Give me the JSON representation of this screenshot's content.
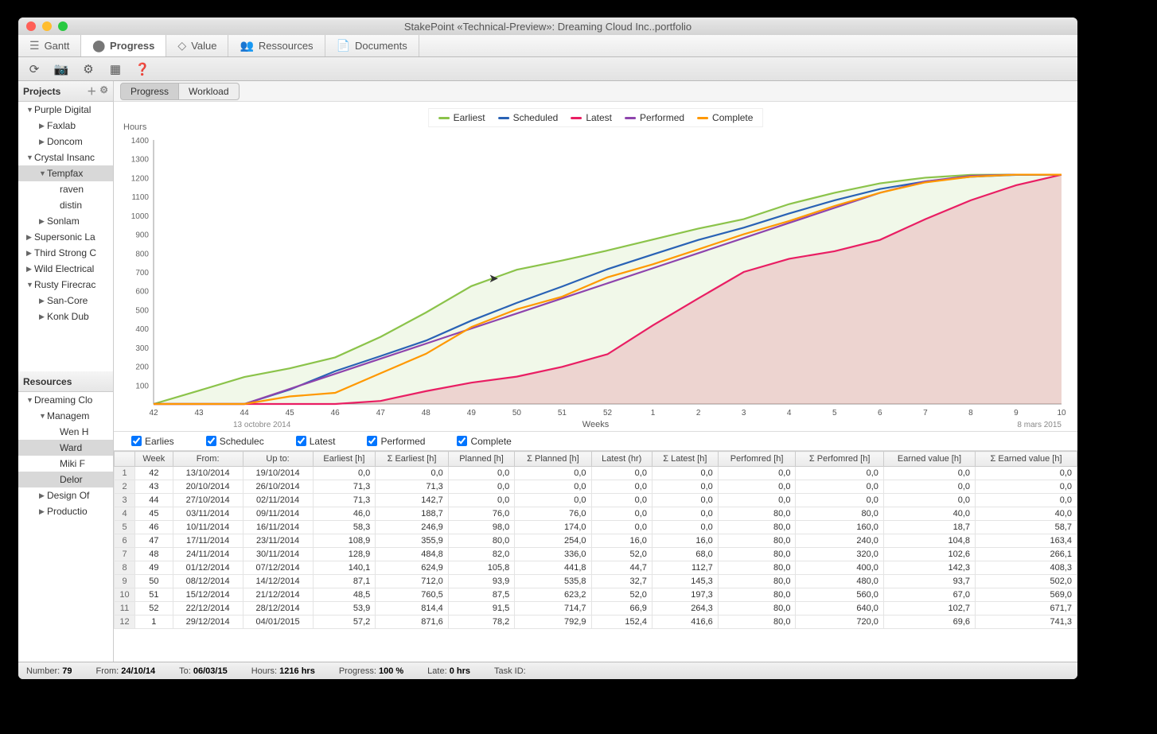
{
  "title": "StakePoint  «Technical-Preview»:  Dreaming Cloud Inc..portfolio",
  "maintabs": [
    "Gantt",
    "Progress",
    "Value",
    "Ressources",
    "Documents"
  ],
  "maintabs_active": 1,
  "sidebar": {
    "projects_label": "Projects",
    "resources_label": "Resources",
    "projects": [
      {
        "l": 1,
        "t": "Purple Digital",
        "a": "▼"
      },
      {
        "l": 2,
        "t": "Faxlab",
        "a": "▶"
      },
      {
        "l": 2,
        "t": "Doncom",
        "a": "▶"
      },
      {
        "l": 1,
        "t": "Crystal Insanc",
        "a": "▼"
      },
      {
        "l": 2,
        "t": "Tempfax",
        "a": "▼",
        "sel": true
      },
      {
        "l": 3,
        "t": "raven",
        "a": ""
      },
      {
        "l": 3,
        "t": "distin",
        "a": ""
      },
      {
        "l": 2,
        "t": "Sonlam",
        "a": "▶"
      },
      {
        "l": 1,
        "t": "Supersonic La",
        "a": "▶"
      },
      {
        "l": 1,
        "t": "Third Strong C",
        "a": "▶"
      },
      {
        "l": 1,
        "t": "Wild Electrical",
        "a": "▶"
      },
      {
        "l": 1,
        "t": "Rusty Firecrac",
        "a": "▼"
      },
      {
        "l": 2,
        "t": "San-Core",
        "a": "▶"
      },
      {
        "l": 2,
        "t": "Konk Dub",
        "a": "▶"
      }
    ],
    "resources": [
      {
        "l": 1,
        "t": "Dreaming Clo",
        "a": "▼"
      },
      {
        "l": 2,
        "t": "Managem",
        "a": "▼"
      },
      {
        "l": 3,
        "t": "Wen H",
        "a": ""
      },
      {
        "l": 3,
        "t": "Ward",
        "a": "",
        "sel": true
      },
      {
        "l": 3,
        "t": "Miki F",
        "a": ""
      },
      {
        "l": 3,
        "t": "Delor",
        "a": "",
        "sel": true
      },
      {
        "l": 2,
        "t": "Design Of",
        "a": "▶"
      },
      {
        "l": 2,
        "t": "Productio",
        "a": "▶"
      }
    ]
  },
  "subtabs": [
    "Progress",
    "Workload"
  ],
  "subtabs_active": 0,
  "legend": [
    {
      "name": "Earliest",
      "color": "#8bc34a"
    },
    {
      "name": "Scheduled",
      "color": "#2962b5"
    },
    {
      "name": "Latest",
      "color": "#e91e63"
    },
    {
      "name": "Performed",
      "color": "#8e44ad"
    },
    {
      "name": "Complete",
      "color": "#ff9800"
    }
  ],
  "ylabel": "Hours",
  "xaxis_label": "Weeks",
  "x_ticks": [
    "42",
    "43",
    "44",
    "45",
    "46",
    "47",
    "48",
    "49",
    "50",
    "51",
    "52",
    "1",
    "2",
    "3",
    "4",
    "5",
    "6",
    "7",
    "8",
    "9",
    "10"
  ],
  "y_ticks": [
    100,
    200,
    300,
    400,
    500,
    600,
    700,
    800,
    900,
    1000,
    1100,
    1200,
    1300,
    1400
  ],
  "date_left": "13 octobre 2014",
  "date_right": "8 mars 2015",
  "checks": [
    "Earlies",
    "Schedulec",
    "Latest",
    "Performed",
    "Complete"
  ],
  "table": {
    "headers": [
      "",
      "Week",
      "From:",
      "Up to:",
      "Earliest [h]",
      "Σ Earliest [h]",
      "Planned [h]",
      "Σ Planned [h]",
      "Latest (hr)",
      "Σ Latest [h]",
      "Perfomred [h]",
      "Σ Perfomred [h]",
      "Earned value [h]",
      "Σ Earned value [h]"
    ],
    "rows": [
      [
        "1",
        "42",
        "13/10/2014",
        "19/10/2014",
        "0,0",
        "0,0",
        "0,0",
        "0,0",
        "0,0",
        "0,0",
        "0,0",
        "0,0",
        "0,0",
        "0,0"
      ],
      [
        "2",
        "43",
        "20/10/2014",
        "26/10/2014",
        "71,3",
        "71,3",
        "0,0",
        "0,0",
        "0,0",
        "0,0",
        "0,0",
        "0,0",
        "0,0",
        "0,0"
      ],
      [
        "3",
        "44",
        "27/10/2014",
        "02/11/2014",
        "71,3",
        "142,7",
        "0,0",
        "0,0",
        "0,0",
        "0,0",
        "0,0",
        "0,0",
        "0,0",
        "0,0"
      ],
      [
        "4",
        "45",
        "03/11/2014",
        "09/11/2014",
        "46,0",
        "188,7",
        "76,0",
        "76,0",
        "0,0",
        "0,0",
        "80,0",
        "80,0",
        "40,0",
        "40,0"
      ],
      [
        "5",
        "46",
        "10/11/2014",
        "16/11/2014",
        "58,3",
        "246,9",
        "98,0",
        "174,0",
        "0,0",
        "0,0",
        "80,0",
        "160,0",
        "18,7",
        "58,7"
      ],
      [
        "6",
        "47",
        "17/11/2014",
        "23/11/2014",
        "108,9",
        "355,9",
        "80,0",
        "254,0",
        "16,0",
        "16,0",
        "80,0",
        "240,0",
        "104,8",
        "163,4"
      ],
      [
        "7",
        "48",
        "24/11/2014",
        "30/11/2014",
        "128,9",
        "484,8",
        "82,0",
        "336,0",
        "52,0",
        "68,0",
        "80,0",
        "320,0",
        "102,6",
        "266,1"
      ],
      [
        "8",
        "49",
        "01/12/2014",
        "07/12/2014",
        "140,1",
        "624,9",
        "105,8",
        "441,8",
        "44,7",
        "112,7",
        "80,0",
        "400,0",
        "142,3",
        "408,3"
      ],
      [
        "9",
        "50",
        "08/12/2014",
        "14/12/2014",
        "87,1",
        "712,0",
        "93,9",
        "535,8",
        "32,7",
        "145,3",
        "80,0",
        "480,0",
        "93,7",
        "502,0"
      ],
      [
        "10",
        "51",
        "15/12/2014",
        "21/12/2014",
        "48,5",
        "760,5",
        "87,5",
        "623,2",
        "52,0",
        "197,3",
        "80,0",
        "560,0",
        "67,0",
        "569,0"
      ],
      [
        "11",
        "52",
        "22/12/2014",
        "28/12/2014",
        "53,9",
        "814,4",
        "91,5",
        "714,7",
        "66,9",
        "264,3",
        "80,0",
        "640,0",
        "102,7",
        "671,7"
      ],
      [
        "12",
        "1",
        "29/12/2014",
        "04/01/2015",
        "57,2",
        "871,6",
        "78,2",
        "792,9",
        "152,4",
        "416,6",
        "80,0",
        "720,0",
        "69,6",
        "741,3"
      ]
    ]
  },
  "status": {
    "number_label": "Number:",
    "number": "79",
    "from_label": "From:",
    "from": "24/10/14",
    "to_label": "To:",
    "to": "06/03/15",
    "hours_label": "Hours:",
    "hours": "1216 hrs",
    "progress_label": "Progress:",
    "progress": "100 %",
    "late_label": "Late:",
    "late": "0 hrs",
    "task_label": "Task ID:"
  },
  "chart_data": {
    "type": "line",
    "title": "",
    "xlabel": "Weeks",
    "ylabel": "Hours",
    "ylim": [
      0,
      1400
    ],
    "categories": [
      "42",
      "43",
      "44",
      "45",
      "46",
      "47",
      "48",
      "49",
      "50",
      "51",
      "52",
      "1",
      "2",
      "3",
      "4",
      "5",
      "6",
      "7",
      "8",
      "9",
      "10"
    ],
    "series": [
      {
        "name": "Earliest",
        "color": "#8bc34a",
        "values": [
          0,
          71,
          143,
          189,
          247,
          356,
          485,
          625,
          712,
          761,
          814,
          872,
          930,
          980,
          1060,
          1120,
          1170,
          1200,
          1215,
          1216,
          1216
        ]
      },
      {
        "name": "Scheduled",
        "color": "#2962b5",
        "values": [
          0,
          0,
          0,
          76,
          174,
          254,
          336,
          442,
          536,
          623,
          715,
          793,
          870,
          935,
          1010,
          1080,
          1140,
          1180,
          1205,
          1215,
          1216
        ]
      },
      {
        "name": "Latest",
        "color": "#e91e63",
        "values": [
          0,
          0,
          0,
          0,
          0,
          16,
          68,
          113,
          145,
          197,
          264,
          417,
          560,
          700,
          770,
          810,
          870,
          980,
          1080,
          1160,
          1216
        ]
      },
      {
        "name": "Performed",
        "color": "#8e44ad",
        "values": [
          0,
          0,
          0,
          80,
          160,
          240,
          320,
          400,
          480,
          560,
          640,
          720,
          800,
          880,
          960,
          1040,
          1120,
          1180,
          1210,
          1216,
          1216
        ]
      },
      {
        "name": "Complete",
        "color": "#ff9800",
        "values": [
          0,
          0,
          0,
          40,
          59,
          163,
          266,
          408,
          502,
          569,
          672,
          741,
          820,
          900,
          970,
          1050,
          1120,
          1175,
          1205,
          1216,
          1216
        ]
      }
    ]
  }
}
